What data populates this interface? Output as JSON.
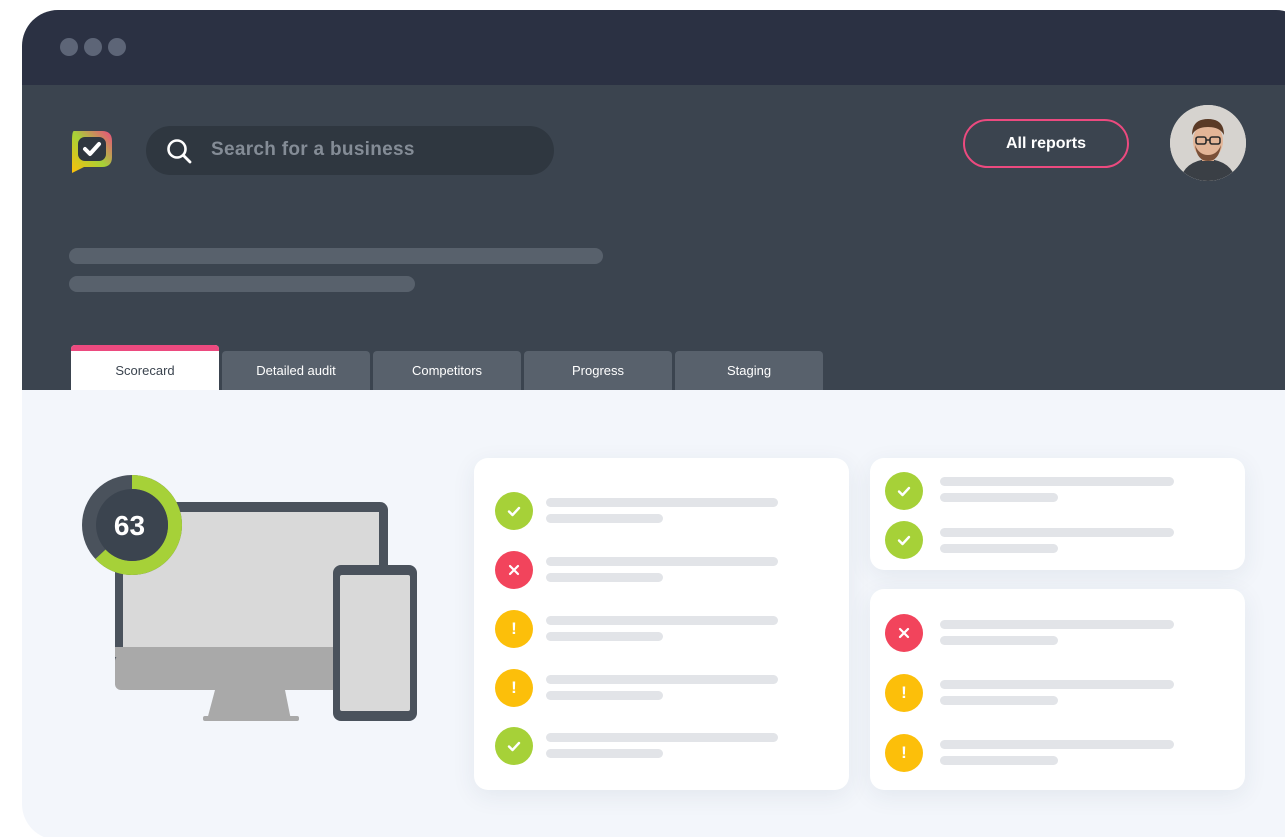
{
  "window": {
    "controls": [
      "dot",
      "dot",
      "dot"
    ]
  },
  "header": {
    "logo": "checkmark-logo",
    "search": {
      "placeholder": "Search for a business",
      "icon": "search-icon"
    },
    "reports_button": "All reports",
    "avatar": "user-avatar"
  },
  "tabs": [
    {
      "label": "Scorecard",
      "active": true
    },
    {
      "label": "Detailed audit",
      "active": false
    },
    {
      "label": "Competitors",
      "active": false
    },
    {
      "label": "Progress",
      "active": false
    },
    {
      "label": "Staging",
      "active": false
    }
  ],
  "score": {
    "value": "63",
    "fraction": 0.63
  },
  "checks": {
    "main": [
      "pass",
      "fail",
      "warning",
      "warning",
      "pass"
    ],
    "side_top": [
      "pass",
      "pass"
    ],
    "side_bottom": [
      "fail",
      "warning",
      "warning"
    ]
  },
  "colors": {
    "accent": "#ec4a7f",
    "pass": "#a6d138",
    "fail": "#f2445c",
    "warning": "#fcbf0a",
    "header": "#3b444f",
    "titlebar": "#2b3143"
  }
}
